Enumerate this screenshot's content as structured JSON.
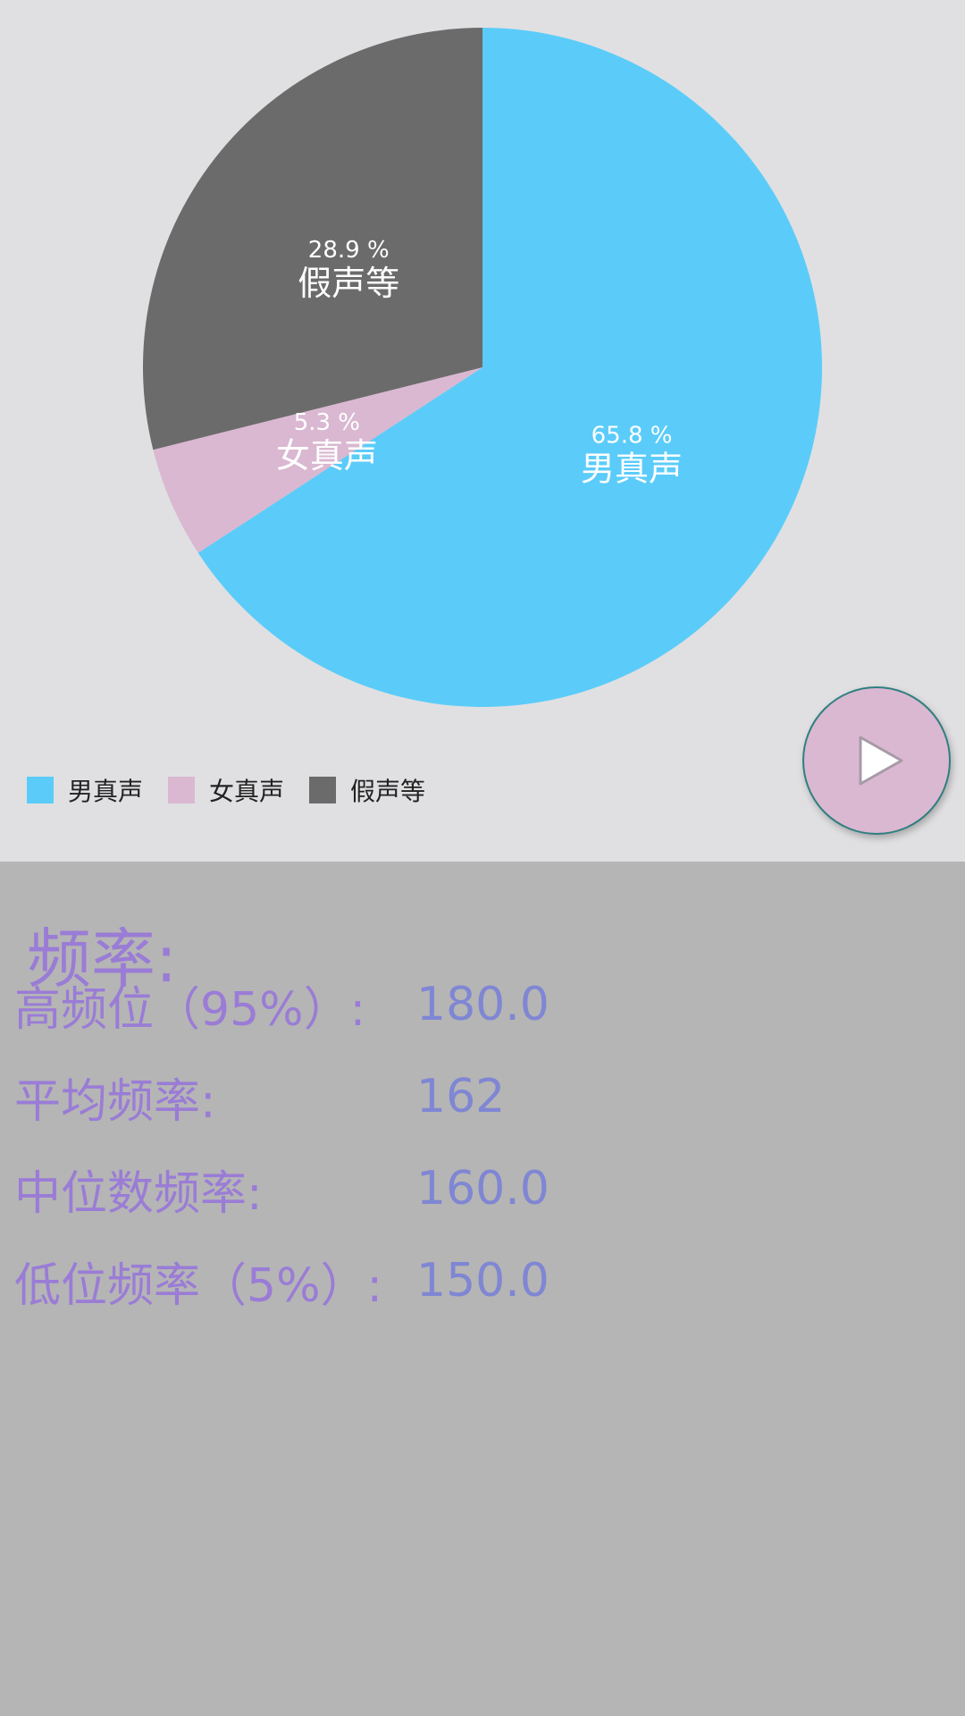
{
  "chart_data": {
    "type": "pie",
    "slices": [
      {
        "label": "男真声",
        "value": 65.8,
        "percent_label": "65.8 %",
        "color": "#5bccf9"
      },
      {
        "label": "女真声",
        "value": 5.3,
        "percent_label": "5.3 %",
        "color": "#dab8d1"
      },
      {
        "label": "假声等",
        "value": 28.9,
        "percent_label": "28.9 %",
        "color": "#6b6b6b"
      }
    ],
    "legend": {
      "placement": "bottom-left",
      "items": [
        {
          "label": "男真声",
          "color": "#5bccf9"
        },
        {
          "label": "女真声",
          "color": "#dab8d1"
        },
        {
          "label": "假声等",
          "color": "#6b6b6b"
        }
      ]
    }
  },
  "play_button": {
    "icon": "play-icon",
    "color": "#dab8d1"
  },
  "stats": {
    "title": "频率:",
    "rows": [
      {
        "label": "高频位（95%）:",
        "value": "180.0"
      },
      {
        "label": "平均频率:",
        "value": "162"
      },
      {
        "label": "中位数频率:",
        "value": "160.0"
      },
      {
        "label": "低位频率（5%）:",
        "value": "150.0"
      }
    ]
  }
}
